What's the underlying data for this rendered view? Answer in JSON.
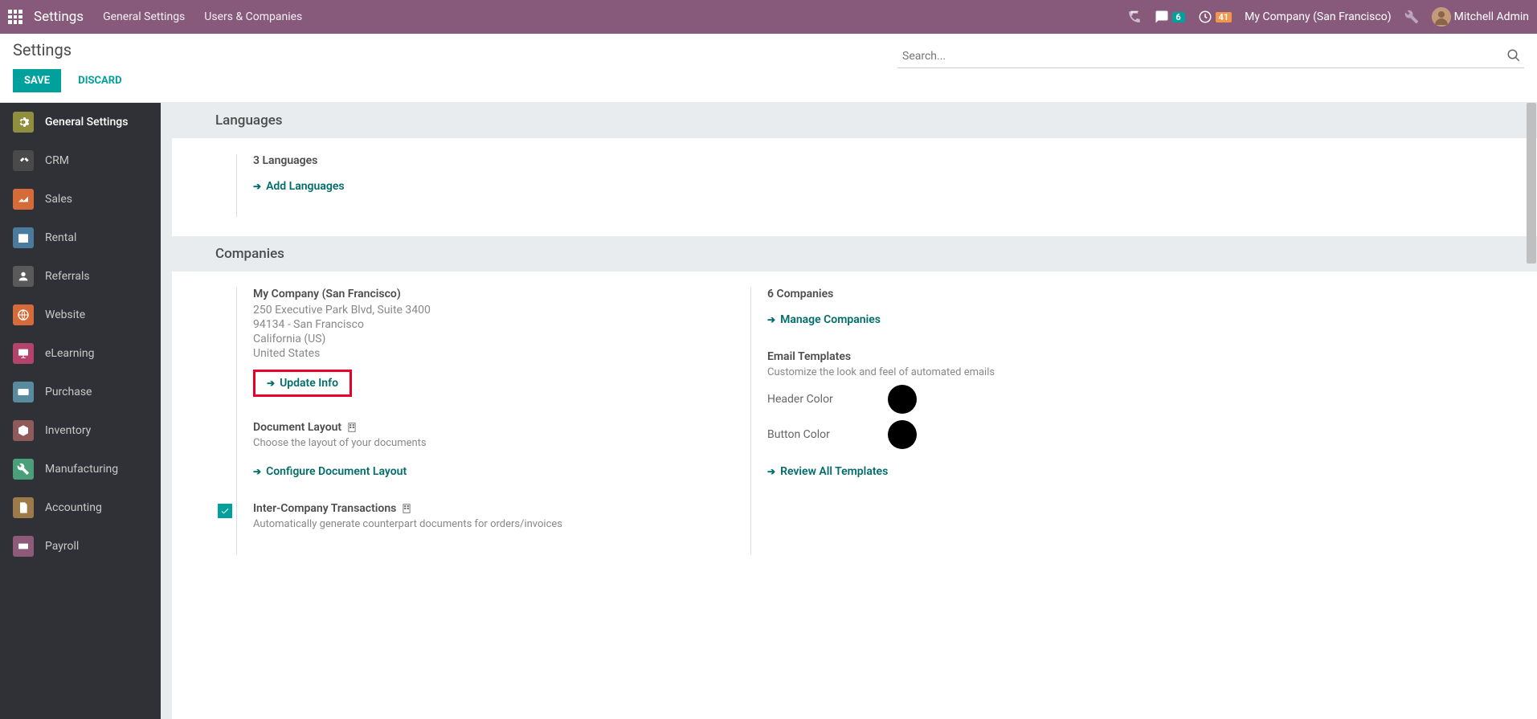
{
  "topbar": {
    "brand": "Settings",
    "menu": [
      "General Settings",
      "Users & Companies"
    ],
    "messages_count": "6",
    "activities_count": "41",
    "company": "My Company (San Francisco)",
    "user": "Mitchell Admin"
  },
  "header": {
    "title": "Settings",
    "save": "SAVE",
    "discard": "DISCARD",
    "search_placeholder": "Search..."
  },
  "sidebar": {
    "items": [
      {
        "label": "General Settings",
        "color": "#8f8f3d",
        "icon": "gear"
      },
      {
        "label": "CRM",
        "color": "#4a4a4a",
        "icon": "handshake"
      },
      {
        "label": "Sales",
        "color": "#d66b3a",
        "icon": "chart"
      },
      {
        "label": "Rental",
        "color": "#4a7a9e",
        "icon": "calendar"
      },
      {
        "label": "Referrals",
        "color": "#5a5a5a",
        "icon": "person"
      },
      {
        "label": "Website",
        "color": "#d66b3a",
        "icon": "globe"
      },
      {
        "label": "eLearning",
        "color": "#b4436c",
        "icon": "board"
      },
      {
        "label": "Purchase",
        "color": "#5a8a9e",
        "icon": "card"
      },
      {
        "label": "Inventory",
        "color": "#8e5a5a",
        "icon": "box"
      },
      {
        "label": "Manufacturing",
        "color": "#4a9e7a",
        "icon": "wrench"
      },
      {
        "label": "Accounting",
        "color": "#9e7a4a",
        "icon": "doc"
      },
      {
        "label": "Payroll",
        "color": "#8e5a7a",
        "icon": "money"
      }
    ]
  },
  "sections": {
    "languages": {
      "title": "Languages",
      "count": "3 Languages",
      "add": "Add Languages"
    },
    "companies": {
      "title": "Companies",
      "company_name": "My Company (San Francisco)",
      "addr1": "250 Executive Park Blvd, Suite 3400",
      "addr2": "94134 - San Francisco",
      "addr3": "California (US)",
      "addr4": "United States",
      "update": "Update Info",
      "count": "6 Companies",
      "manage": "Manage Companies",
      "doc_layout_title": "Document Layout",
      "doc_layout_sub": "Choose the layout of your documents",
      "doc_layout_action": "Configure Document Layout",
      "intercompany_title": "Inter-Company Transactions",
      "intercompany_sub": "Automatically generate counterpart documents for orders/invoices",
      "email_title": "Email Templates",
      "email_sub": "Customize the look and feel of automated emails",
      "header_color_label": "Header Color",
      "button_color_label": "Button Color",
      "review_templates": "Review All Templates"
    }
  }
}
